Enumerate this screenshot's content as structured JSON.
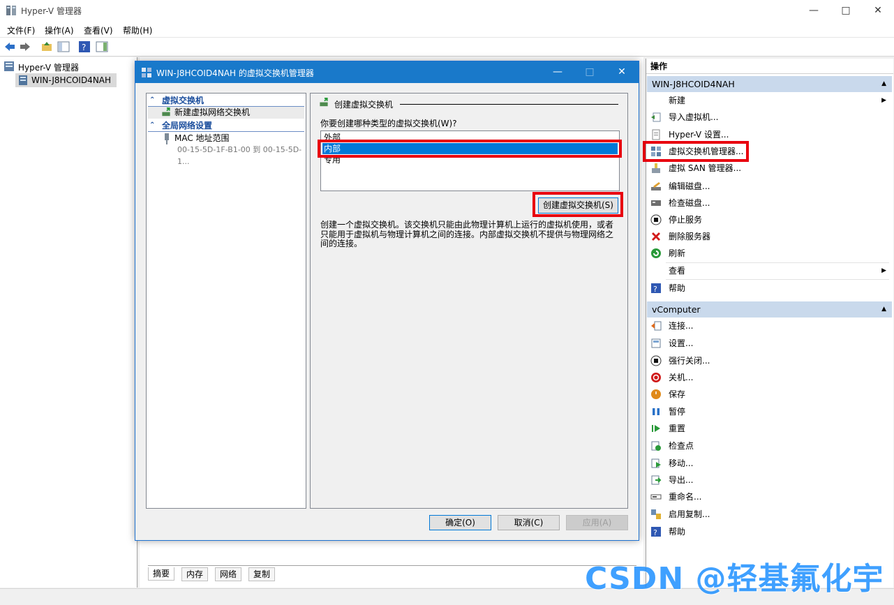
{
  "window": {
    "title": "Hyper-V 管理器"
  },
  "menu": [
    "文件(F)",
    "操作(A)",
    "查看(V)",
    "帮助(H)"
  ],
  "tree": {
    "root": "Hyper-V 管理器",
    "server": "WIN-J8HCOID4NAH"
  },
  "center_tabs": [
    "摘要",
    "内存",
    "网络",
    "复制"
  ],
  "actions": {
    "title": "操作",
    "section1": {
      "title": "WIN-J8HCOID4NAH",
      "items": [
        "新建",
        "导入虚拟机...",
        "Hyper-V 设置...",
        "虚拟交换机管理器...",
        "虚拟 SAN 管理器...",
        "编辑磁盘...",
        "检查磁盘...",
        "停止服务",
        "删除服务器",
        "刷新",
        "查看",
        "帮助"
      ]
    },
    "section2": {
      "title": "vComputer",
      "items": [
        "连接...",
        "设置...",
        "强行关闭...",
        "关机...",
        "保存",
        "暂停",
        "重置",
        "检查点",
        "移动...",
        "导出...",
        "重命名...",
        "启用复制...",
        "帮助"
      ]
    }
  },
  "dialog": {
    "title": "WIN-J8HCOID4NAH 的虚拟交换机管理器",
    "nav": {
      "virtual_switch_header": "虚拟交换机",
      "new_switch": "新建虚拟网络交换机",
      "global_header": "全局网络设置",
      "mac_range": "MAC 地址范围",
      "mac_value": "00-15-5D-1F-B1-00 到 00-15-5D-1..."
    },
    "panel": {
      "group_title": "创建虚拟交换机",
      "question": "你要创建哪种类型的虚拟交换机(W)?",
      "options": [
        "外部",
        "内部",
        "专用"
      ],
      "selected": "内部",
      "create_button": "创建虚拟交换机(S)",
      "description": "创建一个虚拟交换机。该交换机只能由此物理计算机上运行的虚拟机使用，或者只能用于虚拟机与物理计算机之间的连接。内部虚拟交换机不提供与物理网络之间的连接。"
    },
    "buttons": {
      "ok": "确定(O)",
      "cancel": "取消(C)",
      "apply": "应用(A)"
    }
  },
  "watermark": "CSDN @轻基氟化宇",
  "colors": {
    "accent": "#1979ca",
    "selection": "#0078d7",
    "highlight_box": "#e8000f",
    "section_head": "#c9d9ec"
  }
}
